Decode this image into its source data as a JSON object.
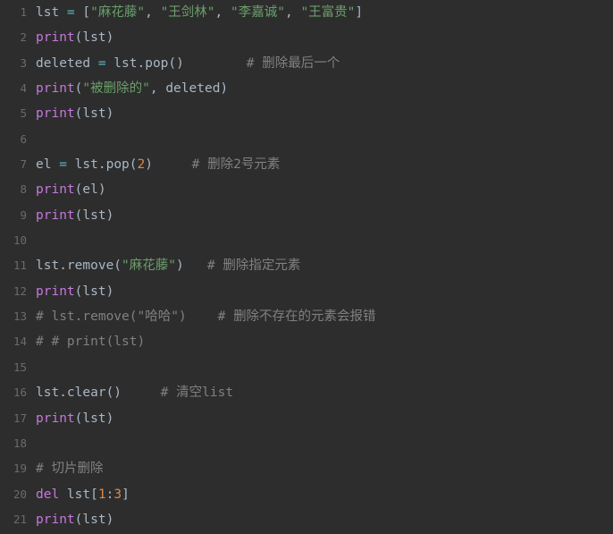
{
  "editor": {
    "name": "python-code-editor",
    "language": "Python",
    "background_color": "#2d2d2d",
    "gutter_color": "#6b6b6b",
    "total_lines": 21,
    "colors": {
      "plain": "#a9b7c6",
      "function": "#c678dd",
      "keyword": "#c678dd",
      "string": "#6a9f6a",
      "number": "#d98a4a",
      "operator": "#56b6c2",
      "comment": "#808080"
    }
  },
  "lines": [
    {
      "number": "1",
      "tokens": [
        {
          "c": "t-plain",
          "t": "lst "
        },
        {
          "c": "t-op",
          "t": "="
        },
        {
          "c": "t-plain",
          "t": " ["
        },
        {
          "c": "t-string",
          "t": "\"麻花藤\""
        },
        {
          "c": "t-plain",
          "t": ", "
        },
        {
          "c": "t-string",
          "t": "\"王剑林\""
        },
        {
          "c": "t-plain",
          "t": ", "
        },
        {
          "c": "t-string",
          "t": "\"李嘉诚\""
        },
        {
          "c": "t-plain",
          "t": ", "
        },
        {
          "c": "t-string",
          "t": "\"王富贵\""
        },
        {
          "c": "t-plain",
          "t": "]"
        }
      ]
    },
    {
      "number": "2",
      "tokens": [
        {
          "c": "t-func",
          "t": "print"
        },
        {
          "c": "t-plain",
          "t": "(lst)"
        }
      ]
    },
    {
      "number": "3",
      "tokens": [
        {
          "c": "t-plain",
          "t": "deleted "
        },
        {
          "c": "t-op",
          "t": "="
        },
        {
          "c": "t-plain",
          "t": " lst.pop()"
        },
        {
          "c": "t-comment",
          "t": "        # 删除最后一个"
        }
      ]
    },
    {
      "number": "4",
      "tokens": [
        {
          "c": "t-func",
          "t": "print"
        },
        {
          "c": "t-plain",
          "t": "("
        },
        {
          "c": "t-string",
          "t": "\"被删除的\""
        },
        {
          "c": "t-plain",
          "t": ", deleted)"
        }
      ]
    },
    {
      "number": "5",
      "tokens": [
        {
          "c": "t-func",
          "t": "print"
        },
        {
          "c": "t-plain",
          "t": "(lst)"
        }
      ]
    },
    {
      "number": "6",
      "tokens": []
    },
    {
      "number": "7",
      "tokens": [
        {
          "c": "t-plain",
          "t": "el "
        },
        {
          "c": "t-op",
          "t": "="
        },
        {
          "c": "t-plain",
          "t": " lst.pop("
        },
        {
          "c": "t-number",
          "t": "2"
        },
        {
          "c": "t-plain",
          "t": ")"
        },
        {
          "c": "t-comment",
          "t": "     # 删除2号元素"
        }
      ]
    },
    {
      "number": "8",
      "tokens": [
        {
          "c": "t-func",
          "t": "print"
        },
        {
          "c": "t-plain",
          "t": "(el)"
        }
      ]
    },
    {
      "number": "9",
      "tokens": [
        {
          "c": "t-func",
          "t": "print"
        },
        {
          "c": "t-plain",
          "t": "(lst)"
        }
      ]
    },
    {
      "number": "10",
      "tokens": []
    },
    {
      "number": "11",
      "tokens": [
        {
          "c": "t-plain",
          "t": "lst.remove("
        },
        {
          "c": "t-string",
          "t": "\"麻花藤\""
        },
        {
          "c": "t-plain",
          "t": ")"
        },
        {
          "c": "t-comment",
          "t": "   # 删除指定元素"
        }
      ]
    },
    {
      "number": "12",
      "tokens": [
        {
          "c": "t-func",
          "t": "print"
        },
        {
          "c": "t-plain",
          "t": "(lst)"
        }
      ]
    },
    {
      "number": "13",
      "tokens": [
        {
          "c": "t-comment",
          "t": "# lst.remove(\"哈哈\")    # 删除不存在的元素会报错"
        }
      ]
    },
    {
      "number": "14",
      "tokens": [
        {
          "c": "t-comment",
          "t": "# # print(lst)"
        }
      ]
    },
    {
      "number": "15",
      "tokens": []
    },
    {
      "number": "16",
      "tokens": [
        {
          "c": "t-plain",
          "t": "lst.clear()"
        },
        {
          "c": "t-comment",
          "t": "     # 清空list"
        }
      ]
    },
    {
      "number": "17",
      "tokens": [
        {
          "c": "t-func",
          "t": "print"
        },
        {
          "c": "t-plain",
          "t": "(lst)"
        }
      ]
    },
    {
      "number": "18",
      "tokens": []
    },
    {
      "number": "19",
      "tokens": [
        {
          "c": "t-comment",
          "t": "# 切片删除"
        }
      ]
    },
    {
      "number": "20",
      "tokens": [
        {
          "c": "t-keyword",
          "t": "del"
        },
        {
          "c": "t-plain",
          "t": " lst["
        },
        {
          "c": "t-number",
          "t": "1"
        },
        {
          "c": "t-plain",
          "t": ":"
        },
        {
          "c": "t-number",
          "t": "3"
        },
        {
          "c": "t-plain",
          "t": "]"
        }
      ]
    },
    {
      "number": "21",
      "tokens": [
        {
          "c": "t-func",
          "t": "print"
        },
        {
          "c": "t-plain",
          "t": "(lst)"
        }
      ]
    }
  ]
}
